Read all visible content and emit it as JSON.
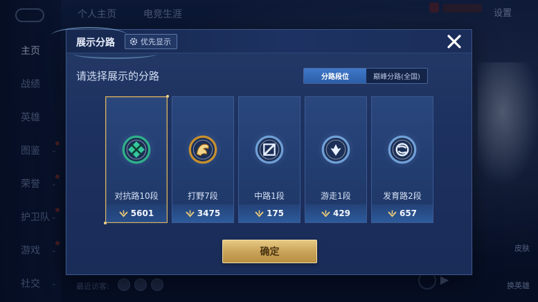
{
  "background": {
    "sidebar": [
      {
        "label": "主页",
        "active": true
      },
      {
        "label": "战绩"
      },
      {
        "label": "英雄"
      },
      {
        "label": "图鉴",
        "has_dot": true
      },
      {
        "label": "荣誉",
        "has_dot": true
      },
      {
        "label": "护卫队",
        "has_dot": true
      },
      {
        "label": "游戏",
        "has_dot": true
      },
      {
        "label": "社交"
      }
    ],
    "top_tabs": [
      "个人主页",
      "电竞生涯"
    ],
    "settings_label": "设置",
    "recent_visitors_label": "最近访客:",
    "skin_label": "皮肤",
    "switch_hero_label": "换英雄"
  },
  "modal": {
    "title": "展示分路",
    "priority_label": "优先显示",
    "prompt": "请选择展示的分路",
    "toggle": {
      "options": [
        "分路段位",
        "巅峰分路(全国)"
      ],
      "selected": "分路段位"
    },
    "cards": [
      {
        "name": "对抗路10段",
        "score": "5601",
        "selected": true,
        "icon": "sword-cross-emblem-icon",
        "emblem_color": "#2fb08a"
      },
      {
        "name": "打野7段",
        "score": "3475",
        "selected": false,
        "icon": "dragon-emblem-icon",
        "emblem_color": "#c7902e"
      },
      {
        "name": "中路1段",
        "score": "175",
        "selected": false,
        "icon": "slash-emblem-icon",
        "emblem_color": "#6f9fd6"
      },
      {
        "name": "游走1段",
        "score": "429",
        "selected": false,
        "icon": "wings-emblem-icon",
        "emblem_color": "#6f9fd6"
      },
      {
        "name": "发育路2段",
        "score": "657",
        "selected": false,
        "icon": "shield-emblem-icon",
        "emblem_color": "#6f9fd6"
      }
    ],
    "confirm_label": "确定"
  },
  "colors": {
    "modal_bg": "#1d3160",
    "accent_gold": "#d9b15d",
    "toggle_active": "#3f78c8",
    "confirm_gold": "#c9a45a"
  }
}
